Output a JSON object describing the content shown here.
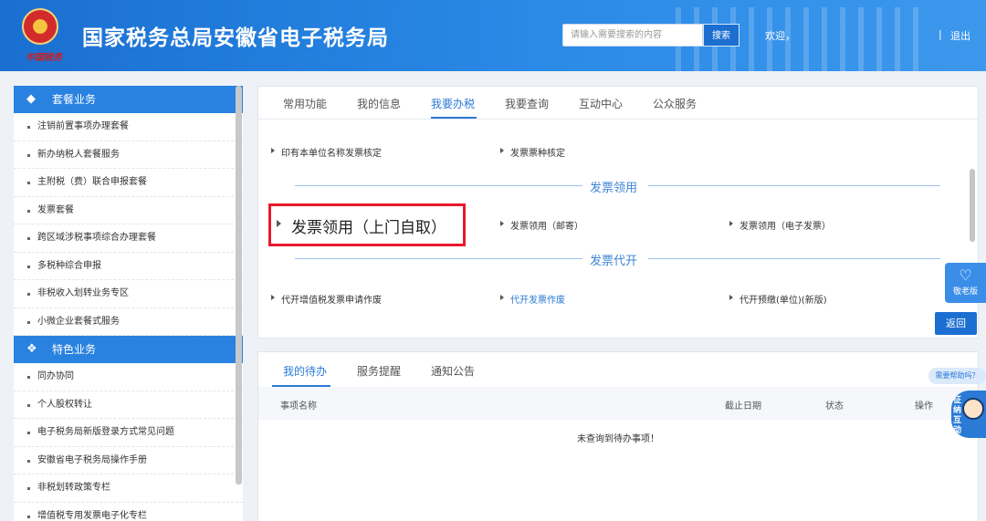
{
  "header": {
    "logo_sign": "中国税务",
    "title": "国家税务总局安徽省电子税务局",
    "search_placeholder": "请输入需要搜索的内容",
    "search_button": "搜索",
    "welcome": "欢迎，",
    "separator": "|",
    "logout": "退出"
  },
  "sidebar": {
    "section1_title": "套餐业务",
    "section1_items": [
      "注销前置事项办理套餐",
      "新办纳税人套餐服务",
      "主附税（费）联合申报套餐",
      "发票套餐",
      "跨区域涉税事项综合办理套餐",
      "多税种综合申报",
      "非税收入划转业务专区",
      "小微企业套餐式服务"
    ],
    "section2_title": "特色业务",
    "section2_items": [
      "同办协同",
      "个人股权转让",
      "电子税务局新版登录方式常见问题",
      "安徽省电子税务局操作手册",
      "非税划转政策专栏",
      "增值税专用发票电子化专栏"
    ]
  },
  "main": {
    "tabs": [
      "常用功能",
      "我的信息",
      "我要办税",
      "我要查询",
      "互动中心",
      "公众服务"
    ],
    "active_tab": "我要办税",
    "row1": [
      "印有本单位名称发票核定",
      "发票票种核定"
    ],
    "section_lingyong": "发票领用",
    "lingyong_links": [
      "发票领用（上门自取）",
      "发票领用（邮寄）",
      "发票领用（电子发票）"
    ],
    "section_daikai": "发票代开",
    "daikai_links": [
      "代开增值税发票申请作废",
      "代开发票作废",
      "代开预缴(单位)(新版)"
    ],
    "back_button": "返回"
  },
  "todo": {
    "tabs": [
      "我的待办",
      "服务提醒",
      "通知公告"
    ],
    "columns": [
      "事项名称",
      "截止日期",
      "状态",
      "操作"
    ],
    "empty_text": "未查询到待办事项！"
  },
  "float": {
    "elder_label": "敬老版",
    "help_tip": "需要帮助吗？",
    "assistant_text": "征纳互动"
  }
}
